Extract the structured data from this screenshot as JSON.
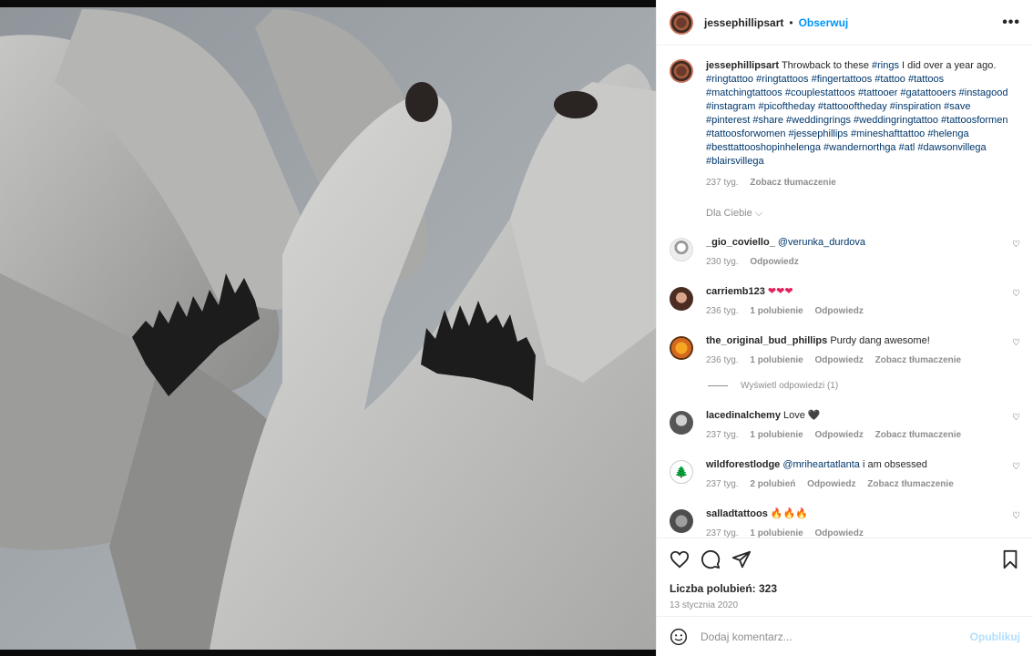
{
  "post": {
    "username": "jessephillipsart",
    "follow_label": "Obserwuj",
    "more_label": "•••",
    "caption_text": "Throwback to these",
    "caption_tag_rings": "#rings",
    "caption_text_2": "I did over a year ago.",
    "hashtags": "#ringtattoo #ringtattoos #fingertattoos #tattoo #tattoos #matchingtattoos #couplestattoos #tattooer #gatattooers #instagood #instagram #picoftheday #tattoooftheday #inspiration #save #pinterest #share #weddingrings #weddingringtattoo #tattoosformen #tattoosforwomen #jessephillips #mineshafttattoo #helenga #besttattooshopinhelenga #wandernorthga #atl #dawsonvillega #blairsvillega",
    "caption_age": "237 tyg.",
    "see_translation": "Zobacz tłumaczenie",
    "for_you": "Dla Ciebie"
  },
  "comments": [
    {
      "user": "_gio_coviello_",
      "text": "@verunka_durdova",
      "text_is_mention": true,
      "age": "230 tyg.",
      "likes": "",
      "reply": "Odpowiedz",
      "translate": ""
    },
    {
      "user": "carriemb123",
      "text": "❤❤❤",
      "text_is_hearts": true,
      "age": "236 tyg.",
      "likes": "1 polubienie",
      "reply": "Odpowiedz",
      "translate": ""
    },
    {
      "user": "the_original_bud_phillips",
      "text": "Purdy dang awesome!",
      "age": "236 tyg.",
      "likes": "1 polubienie",
      "reply": "Odpowiedz",
      "translate": "Zobacz tłumaczenie",
      "view_replies": "Wyświetl odpowiedzi (1)"
    },
    {
      "user": "lacedinalchemy",
      "text": "Love 🖤",
      "age": "237 tyg.",
      "likes": "1 polubienie",
      "reply": "Odpowiedz",
      "translate": "Zobacz tłumaczenie"
    },
    {
      "user": "wildforestlodge",
      "mention": "@mriheartatlanta",
      "text": "i am obsessed",
      "age": "237 tyg.",
      "likes": "2 polubień",
      "reply": "Odpowiedz",
      "translate": "Zobacz tłumaczenie"
    },
    {
      "user": "salladtattoos",
      "text": "🔥🔥🔥",
      "age": "237 tyg.",
      "likes": "1 polubienie",
      "reply": "Odpowiedz",
      "translate": ""
    }
  ],
  "footer": {
    "likes": "Liczba polubień: 323",
    "date": "13 stycznia 2020",
    "add_comment_placeholder": "Dodaj komentarz...",
    "publish": "Opublikuj"
  },
  "icons": {
    "like": "heart-icon",
    "comment": "comment-icon",
    "share": "share-icon",
    "save": "bookmark-icon",
    "emoji": "emoji-icon",
    "comment_like": "small-heart-icon"
  },
  "colors": {
    "link": "#0095f6",
    "hashtag": "#00376b",
    "muted": "#8e8e8e"
  }
}
